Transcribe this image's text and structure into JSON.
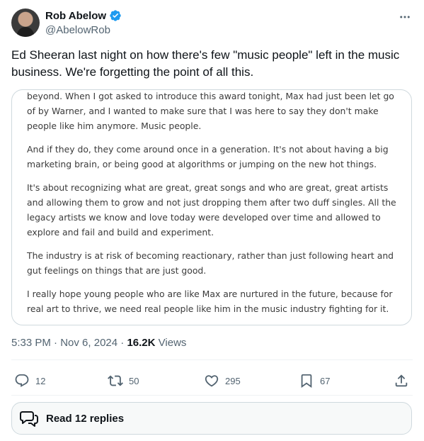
{
  "author": {
    "name": "Rob Abelow",
    "handle": "@AbelowRob"
  },
  "tweet": {
    "text": "Ed Sheeran last night on how there's few \"music people\" left in the music business. We're forgetting the point of all this."
  },
  "media": {
    "paragraphs": [
      "beyond. When I got asked to introduce this award tonight, Max had just been let go of by Warner, and I wanted to make sure that I was here to say they don't make people like him anymore. Music people.",
      "And if they do, they come around once in a generation. It's not about having a big marketing brain, or being good at algorithms or jumping on the new hot things.",
      "It's about recognizing what are great, great songs and who are great, great artists and allowing them to grow and not just dropping them after two duff singles. All the legacy artists we know and love today were developed over time and allowed to explore and fail and build and experiment.",
      "The industry is at risk of becoming reactionary, rather than just following heart and gut feelings on things that are just good.",
      "I really hope young people who are like Max are nurtured in the future, because for real art to thrive, we need real people like him in the music industry fighting for it."
    ]
  },
  "meta": {
    "time": "5:33 PM",
    "date": "Nov 6, 2024",
    "separator": "·",
    "views_count": "16.2K",
    "views_label": "Views"
  },
  "actions": {
    "replies": "12",
    "reposts": "50",
    "likes": "295",
    "bookmarks": "67"
  },
  "read_replies": {
    "label": "Read 12 replies"
  },
  "icons": {
    "verified": "verified-badge-icon",
    "more": "more-icon",
    "reply": "reply-icon",
    "repost": "repost-icon",
    "like": "heart-icon",
    "bookmark": "bookmark-icon",
    "share": "share-icon",
    "replies": "speech-bubbles-icon"
  },
  "colors": {
    "verified": "#1d9bf0",
    "text": "#0f1419",
    "secondary": "#536471",
    "border": "#cfd9de"
  }
}
